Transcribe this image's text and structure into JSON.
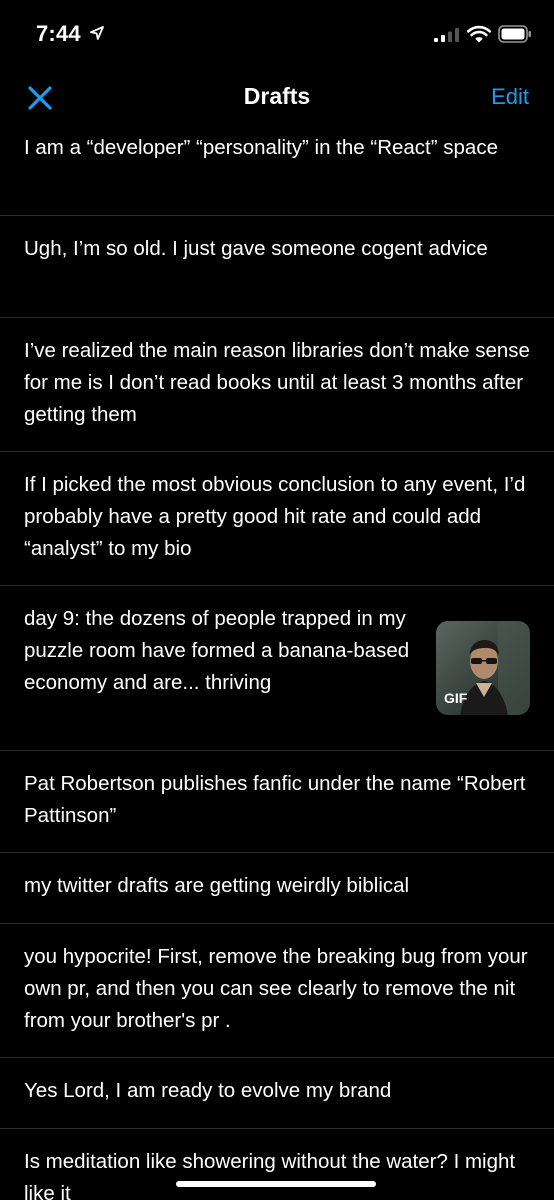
{
  "status_bar": {
    "time": "7:44"
  },
  "nav": {
    "title": "Drafts",
    "edit_label": "Edit"
  },
  "drafts": [
    {
      "text": "I am a “developer” “personality” in the “React” space"
    },
    {
      "text": "Ugh, I’m so old. I just gave someone cogent advice"
    },
    {
      "text": "I’ve realized the main reason libraries don’t make sense for me is I don’t read books until at least 3 months after getting them"
    },
    {
      "text": "If I picked the most obvious conclusion to any event, I’d probably have a pretty good hit rate and could add “analyst” to my bio"
    },
    {
      "text": "day  9: the dozens of people trapped in my puzzle room have formed a banana-based economy and are... thriving",
      "media_badge": "GIF"
    },
    {
      "text": "Pat Robertson publishes fanfic under the name “Robert Pattinson”"
    },
    {
      "text": "my twitter drafts are getting weirdly biblical"
    },
    {
      "text": "you hypocrite! First, remove the breaking bug from your own pr, and then you can see clearly to remove the nit from your brother's pr ."
    },
    {
      "text": "Yes Lord, I am ready to evolve my brand"
    },
    {
      "text": "Is meditation like showering without the water? I might like it"
    }
  ],
  "colors": {
    "background": "#000000",
    "accent": "#1d9bf0",
    "divider": "#2a2d30",
    "text": "#ffffff"
  }
}
